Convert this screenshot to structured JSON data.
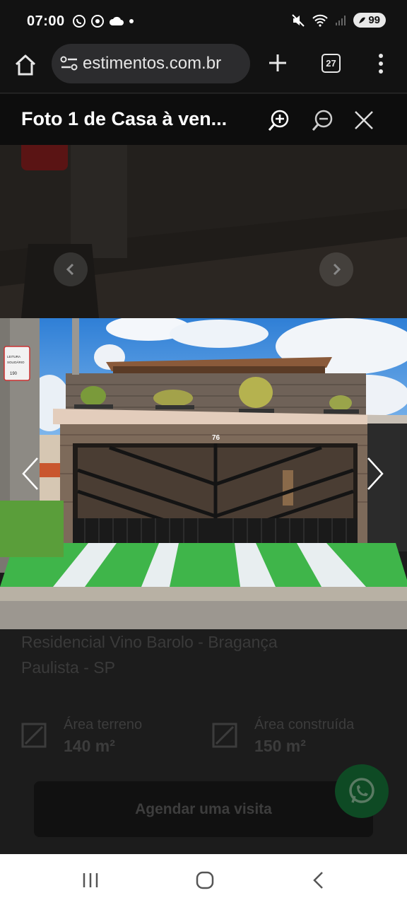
{
  "status_bar": {
    "time": "07:00",
    "battery": "99"
  },
  "browser": {
    "url": "estimentos.com.br",
    "tab_count": "27"
  },
  "lightbox": {
    "title": "Foto 1 de Casa à ven..."
  },
  "photo": {
    "house_number": "76",
    "sign_line1": "LEITURA",
    "sign_line2": "SOLIDÁRIO",
    "sign_number": "190"
  },
  "listing": {
    "title": "Residencial Vino Barolo - Bragança Paulista - SP",
    "features": [
      {
        "label": "Área terreno",
        "value": "140 m²"
      },
      {
        "label": "Área construída",
        "value": "150 m²"
      }
    ],
    "cta_label": "Agendar uma visita"
  },
  "colors": {
    "status_bg": "#121212",
    "header_bg": "#0d0d0d",
    "page_bg": "#1c1c1c",
    "whatsapp": "#0e4a24",
    "grass": "#3fb54a"
  }
}
